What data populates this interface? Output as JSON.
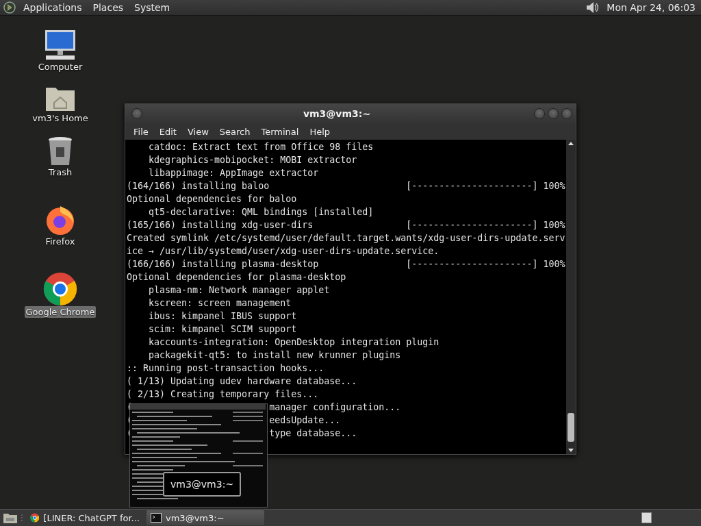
{
  "top_panel": {
    "menus": [
      "Applications",
      "Places",
      "System"
    ],
    "clock": "Mon Apr 24, 06:03"
  },
  "desktop_icons": [
    {
      "kind": "computer",
      "label": "Computer",
      "selected": false
    },
    {
      "kind": "home",
      "label": "vm3's Home",
      "selected": false
    },
    {
      "kind": "trash",
      "label": "Trash",
      "selected": false
    },
    {
      "kind": "firefox",
      "label": "Firefox",
      "selected": false
    },
    {
      "kind": "chrome",
      "label": "Google Chrome",
      "selected": true
    }
  ],
  "terminal": {
    "title": "vm3@vm3:~",
    "menu": [
      "File",
      "Edit",
      "View",
      "Search",
      "Terminal",
      "Help"
    ],
    "lines": [
      {
        "kind": "indent",
        "text": "catdoc: Extract text from Office 98 files"
      },
      {
        "kind": "indent",
        "text": "kdegraphics-mobipocket: MOBI extractor"
      },
      {
        "kind": "indent",
        "text": "libappimage: AppImage extractor"
      },
      {
        "kind": "progress",
        "text": "(164/166) installing baloo",
        "bar": "[----------------------]",
        "percent": "100%"
      },
      {
        "kind": "plain",
        "text": "Optional dependencies for baloo"
      },
      {
        "kind": "indent",
        "text": "qt5-declarative: QML bindings [installed]"
      },
      {
        "kind": "progress",
        "text": "(165/166) installing xdg-user-dirs",
        "bar": "[----------------------]",
        "percent": "100%"
      },
      {
        "kind": "plain",
        "text": "Created symlink /etc/systemd/user/default.target.wants/xdg-user-dirs-update.serv"
      },
      {
        "kind": "plain",
        "text": "ice → /usr/lib/systemd/user/xdg-user-dirs-update.service."
      },
      {
        "kind": "progress",
        "text": "(166/166) installing plasma-desktop",
        "bar": "[----------------------]",
        "percent": "100%"
      },
      {
        "kind": "plain",
        "text": "Optional dependencies for plasma-desktop"
      },
      {
        "kind": "indent",
        "text": "plasma-nm: Network manager applet"
      },
      {
        "kind": "indent",
        "text": "kscreen: screen management"
      },
      {
        "kind": "indent",
        "text": "ibus: kimpanel IBUS support"
      },
      {
        "kind": "indent",
        "text": "scim: kimpanel SCIM support"
      },
      {
        "kind": "indent",
        "text": "kaccounts-integration: OpenDesktop integration plugin"
      },
      {
        "kind": "indent",
        "text": "packagekit-qt5: to install new krunner plugins"
      },
      {
        "kind": "plain",
        "text": ":: Running post-transaction hooks..."
      },
      {
        "kind": "plain",
        "text": "( 1/13) Updating udev hardware database..."
      },
      {
        "kind": "plain",
        "text": "( 2/13) Creating temporary files..."
      },
      {
        "kind": "covered",
        "text": "(",
        "right": "manager configuration..."
      },
      {
        "kind": "covered",
        "text": "(",
        "right": "eedsUpdate..."
      },
      {
        "kind": "covered",
        "text": "(",
        "right": "type database..."
      }
    ]
  },
  "preview": {
    "label": "vm3@vm3:~"
  },
  "taskbar": {
    "tasks": [
      {
        "kind": "chrome",
        "label": "[LINER: ChatGPT for...",
        "selected": false
      },
      {
        "kind": "terminal",
        "label": "vm3@vm3:~",
        "selected": true
      }
    ]
  }
}
